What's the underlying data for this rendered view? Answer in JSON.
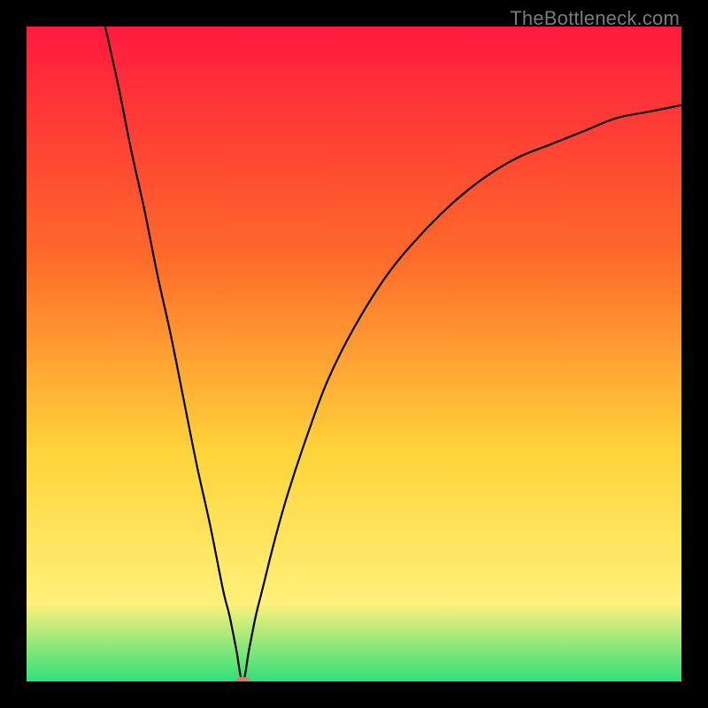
{
  "watermark": "TheBottleneck.com",
  "colors": {
    "black": "#000000",
    "gradient_top": "#ff1a3f",
    "gradient_mid1": "#ff6a2a",
    "gradient_mid2": "#ffd43a",
    "gradient_mid3": "#fff07a",
    "gradient_bottom": "#2fe07a",
    "curve": "#000000",
    "marker": "#d97a6a"
  },
  "chart_data": {
    "type": "line",
    "title": "",
    "xlabel": "",
    "ylabel": "",
    "xlim": [
      0,
      100
    ],
    "ylim": [
      0,
      100
    ],
    "x_min_at": 33,
    "series": [
      {
        "name": "bottleneck-curve",
        "x": [
          12,
          14,
          16,
          18,
          20,
          22,
          24,
          26,
          28,
          30,
          31,
          32,
          33,
          34,
          35,
          36,
          38,
          40,
          43,
          46,
          50,
          55,
          60,
          65,
          70,
          75,
          80,
          85,
          90,
          95,
          100
        ],
        "values": [
          100,
          91,
          81,
          72,
          62,
          53,
          43,
          33,
          24,
          14,
          10,
          5,
          0,
          5,
          10,
          14,
          22,
          29,
          38,
          46,
          54,
          62,
          68,
          73,
          77,
          80,
          82,
          84,
          86,
          87,
          88
        ]
      }
    ],
    "marker": {
      "x": 33,
      "y": 0,
      "rx": 1.2,
      "ry": 0.7
    },
    "annotations": []
  }
}
